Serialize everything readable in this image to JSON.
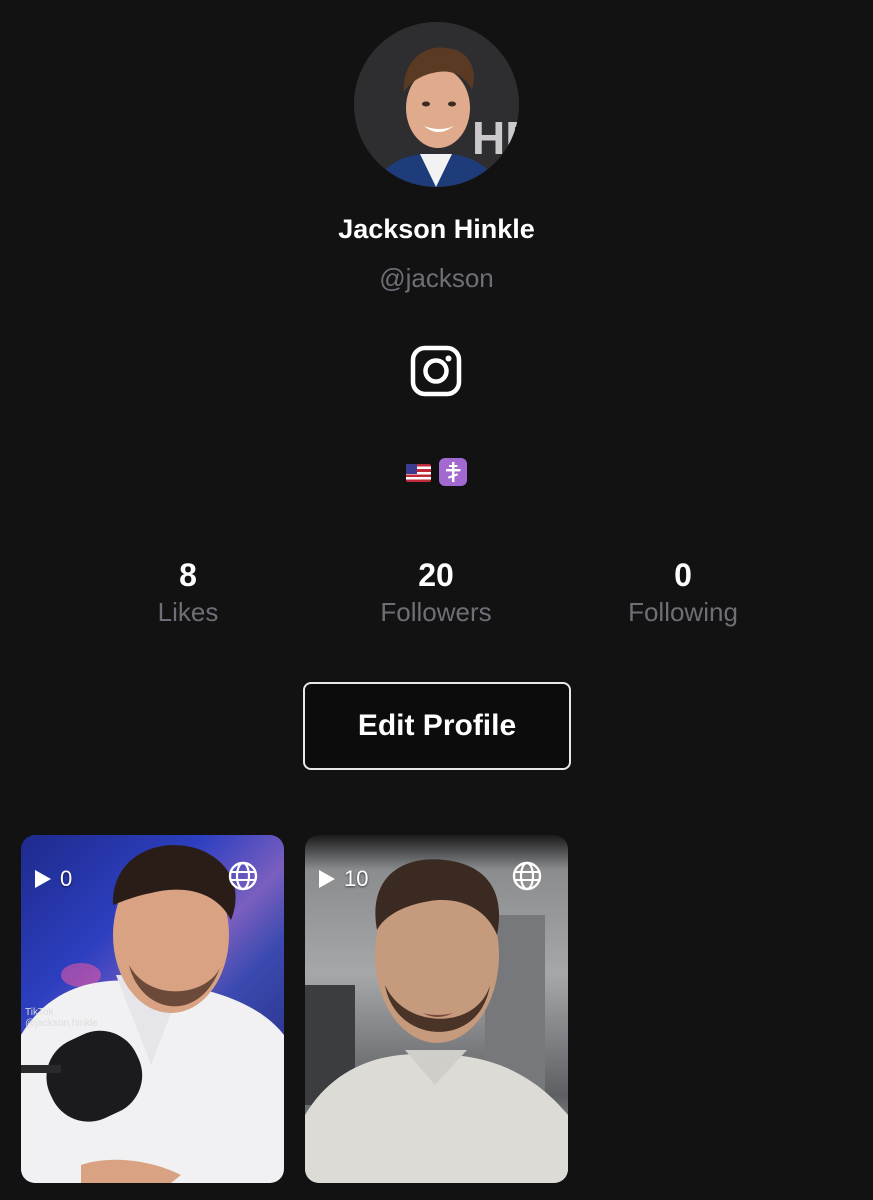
{
  "profile": {
    "display_name": "Jackson Hinkle",
    "username": "@jackson",
    "social_icon": "instagram-icon",
    "bio_icons": [
      "us-flag-emoji",
      "orthodox-cross-emoji"
    ]
  },
  "stats": [
    {
      "value": "8",
      "label": "Likes"
    },
    {
      "value": "20",
      "label": "Followers"
    },
    {
      "value": "0",
      "label": "Following"
    }
  ],
  "edit_button_label": "Edit Profile",
  "videos": [
    {
      "views": "0",
      "visibility_icon": "globe-icon",
      "watermark": "TikTok",
      "watermark_handle": "@jackson.hinkle"
    },
    {
      "views": "10",
      "visibility_icon": "globe-icon"
    }
  ],
  "colors": {
    "background": "#121212",
    "muted_text": "#6e6e76",
    "button_border": "#e8e8e8"
  }
}
